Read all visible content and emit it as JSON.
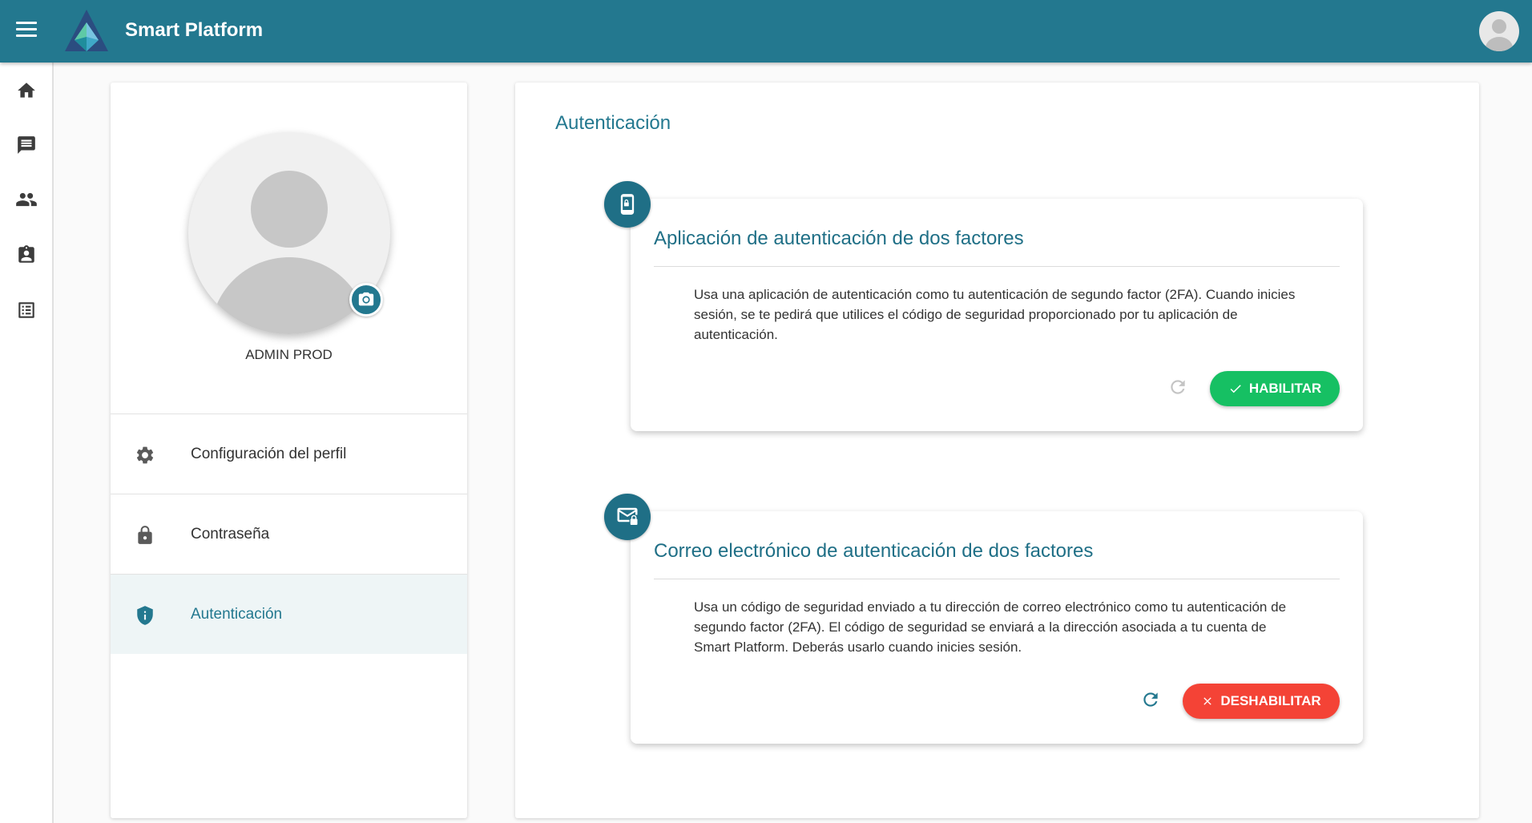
{
  "app": {
    "title": "Smart Platform"
  },
  "profile": {
    "name": "ADMIN PROD",
    "menu": [
      {
        "label": "Configuración del perfil",
        "icon": "gear-icon"
      },
      {
        "label": "Contraseña",
        "icon": "lock-icon"
      },
      {
        "label": "Autenticación",
        "icon": "shield-icon",
        "active": true
      }
    ]
  },
  "main": {
    "section_title": "Autenticación",
    "cards": [
      {
        "title": "Aplicación de autenticación de dos factores",
        "description": "Usa una aplicación de autenticación como tu autenticación de segundo factor (2FA). Cuando inicies sesión, se te pedirá que utilices el código de seguridad proporcionado por tu aplicación de autenticación.",
        "icon": "phone-lock-icon",
        "button": "HABILITAR",
        "button_color": "#16c063",
        "refresh_enabled": false
      },
      {
        "title": "Correo electrónico de autenticación de dos factores",
        "description": "Usa un código de seguridad enviado a tu dirección de correo electrónico como tu autenticación de segundo factor (2FA). El código de seguridad se enviará a la dirección asociada a tu cuenta de Smart Platform. Deberás usarlo cuando inicies sesión.",
        "icon": "mail-lock-icon",
        "button": "DESHABILITAR",
        "button_color": "#f44336",
        "refresh_enabled": true
      }
    ]
  },
  "colors": {
    "primary": "#23788f",
    "enable": "#16c063",
    "disable": "#f44336"
  }
}
